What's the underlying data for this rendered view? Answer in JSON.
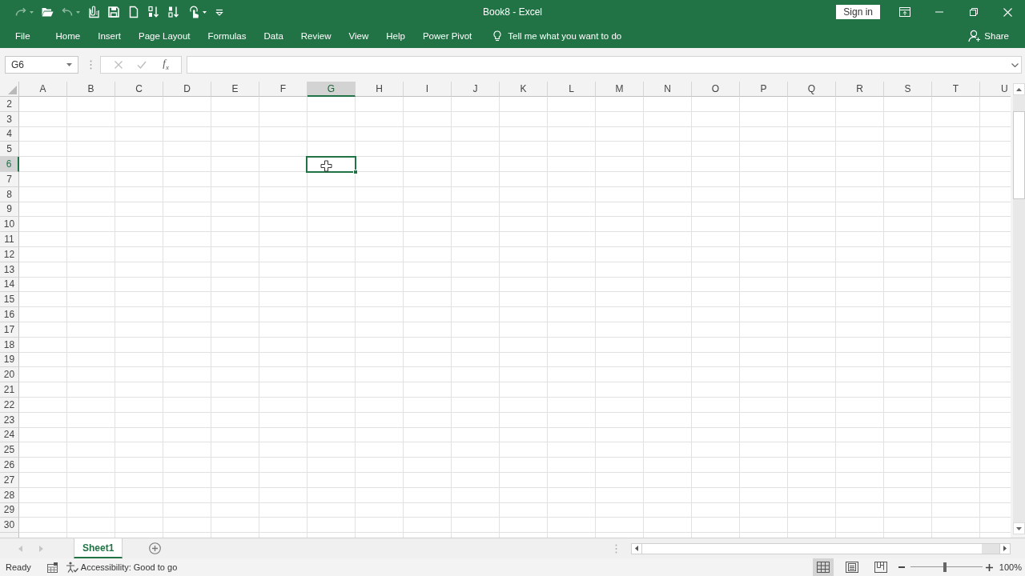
{
  "title_bar": {
    "quick_access": [
      {
        "kind": "redo",
        "disabled": true,
        "dropdown": true
      },
      {
        "kind": "open",
        "disabled": false,
        "dropdown": false
      },
      {
        "kind": "undo",
        "disabled": true,
        "dropdown": true
      },
      {
        "kind": "attach",
        "disabled": false,
        "dropdown": false
      },
      {
        "kind": "save",
        "disabled": false,
        "dropdown": false
      },
      {
        "kind": "new",
        "disabled": false,
        "dropdown": false
      },
      {
        "kind": "sort_ascending",
        "disabled": false,
        "dropdown": false
      },
      {
        "kind": "sort_descending",
        "disabled": false,
        "dropdown": false
      },
      {
        "kind": "touch_mode",
        "disabled": false,
        "dropdown": true
      },
      {
        "kind": "customize",
        "disabled": false,
        "dropdown": false
      }
    ],
    "title": "Book8 - Excel",
    "sign_in": "Sign in"
  },
  "ribbon": {
    "tabs": [
      "File",
      "Home",
      "Insert",
      "Page Layout",
      "Formulas",
      "Data",
      "Review",
      "View",
      "Help",
      "Power Pivot"
    ],
    "tell_me": {
      "placeholder": "Tell me what you want to do"
    },
    "share": "Share"
  },
  "formula_bar": {
    "name_box": "G6",
    "buttons": [
      {
        "kind": "cancel",
        "disabled": true
      },
      {
        "kind": "enter",
        "disabled": true
      }
    ],
    "function_button": "f$_{x}$"
  },
  "grid": {
    "columns": [
      {
        "label": "A",
        "selected": false
      },
      {
        "label": "B",
        "selected": false
      },
      {
        "label": "C",
        "selected": false
      },
      {
        "label": "D",
        "selected": false
      },
      {
        "label": "E",
        "selected": false
      },
      {
        "label": "F",
        "selected": false
      },
      {
        "label": "G",
        "selected": true
      },
      {
        "label": "H",
        "selected": false
      },
      {
        "label": "I",
        "selected": false
      },
      {
        "label": "J",
        "selected": false
      },
      {
        "label": "K",
        "selected": false
      },
      {
        "label": "L",
        "selected": false
      },
      {
        "label": "M",
        "selected": false
      },
      {
        "label": "N",
        "selected": false
      },
      {
        "label": "O",
        "selected": false
      },
      {
        "label": "P",
        "selected": false
      },
      {
        "label": "Q",
        "selected": false
      },
      {
        "label": "R",
        "selected": false
      },
      {
        "label": "S",
        "selected": false
      },
      {
        "label": "T",
        "selected": false
      },
      {
        "label": "U",
        "selected": false
      }
    ],
    "rows": [
      {
        "label": "2",
        "selected": false
      },
      {
        "label": "3",
        "selected": false
      },
      {
        "label": "4",
        "selected": false
      },
      {
        "label": "5",
        "selected": false
      },
      {
        "label": "6",
        "selected": true
      },
      {
        "label": "7",
        "selected": false
      },
      {
        "label": "8",
        "selected": false
      },
      {
        "label": "9",
        "selected": false
      },
      {
        "label": "10",
        "selected": false
      },
      {
        "label": "11",
        "selected": false
      },
      {
        "label": "12",
        "selected": false
      },
      {
        "label": "13",
        "selected": false
      },
      {
        "label": "14",
        "selected": false
      },
      {
        "label": "15",
        "selected": false
      },
      {
        "label": "16",
        "selected": false
      },
      {
        "label": "17",
        "selected": false
      },
      {
        "label": "18",
        "selected": false
      },
      {
        "label": "19",
        "selected": false
      },
      {
        "label": "20",
        "selected": false
      },
      {
        "label": "21",
        "selected": false
      },
      {
        "label": "22",
        "selected": false
      },
      {
        "label": "23",
        "selected": false
      },
      {
        "label": "24",
        "selected": false
      },
      {
        "label": "25",
        "selected": false
      },
      {
        "label": "26",
        "selected": false
      },
      {
        "label": "27",
        "selected": false
      },
      {
        "label": "28",
        "selected": false
      },
      {
        "label": "29",
        "selected": false
      },
      {
        "label": "30",
        "selected": false
      }
    ]
  },
  "sheet_bar": {
    "navigation": [
      {
        "kind": "previous",
        "disabled": true
      },
      {
        "kind": "next",
        "disabled": true
      }
    ],
    "sheets": [
      {
        "label": "Sheet1",
        "selected": true
      }
    ]
  },
  "status_bar": {
    "mode": "Ready",
    "accessibility": "Accessibility: Good to go",
    "views": [
      {
        "kind": "normal",
        "selected": true
      },
      {
        "kind": "page_layout",
        "selected": false
      },
      {
        "kind": "page_break_preview",
        "selected": false
      }
    ],
    "zoom": {
      "level": 0.48,
      "reading": "100%"
    }
  }
}
